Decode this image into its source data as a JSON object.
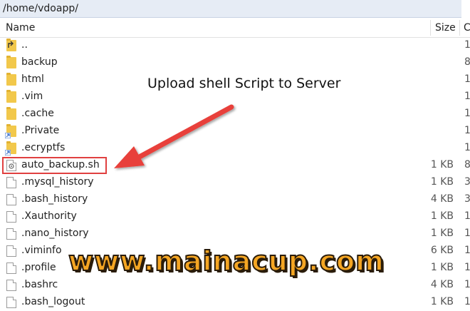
{
  "path": "/home/vdoapp/",
  "columns": {
    "name": "Name",
    "size": "Size",
    "third": "C"
  },
  "rows": [
    {
      "name": "..",
      "size": "",
      "extra": "1",
      "icon": "parent-folder-icon"
    },
    {
      "name": "backup",
      "size": "",
      "extra": "8",
      "icon": "folder-icon"
    },
    {
      "name": "html",
      "size": "",
      "extra": "1",
      "icon": "folder-icon"
    },
    {
      "name": ".vim",
      "size": "",
      "extra": "1",
      "icon": "folder-icon"
    },
    {
      "name": ".cache",
      "size": "",
      "extra": "1",
      "icon": "folder-icon"
    },
    {
      "name": ".Private",
      "size": "",
      "extra": "1",
      "icon": "folder-link-icon"
    },
    {
      "name": ".ecryptfs",
      "size": "",
      "extra": "1",
      "icon": "folder-link-icon"
    },
    {
      "name": "auto_backup.sh",
      "size": "1 KB",
      "extra": "8",
      "icon": "script-file-icon"
    },
    {
      "name": ".mysql_history",
      "size": "1 KB",
      "extra": "3",
      "icon": "file-icon"
    },
    {
      "name": ".bash_history",
      "size": "4 KB",
      "extra": "3",
      "icon": "file-icon"
    },
    {
      "name": ".Xauthority",
      "size": "1 KB",
      "extra": "1",
      "icon": "file-icon"
    },
    {
      "name": ".nano_history",
      "size": "1 KB",
      "extra": "1",
      "icon": "file-icon"
    },
    {
      "name": ".viminfo",
      "size": "6 KB",
      "extra": "1",
      "icon": "file-icon"
    },
    {
      "name": ".profile",
      "size": "1 KB",
      "extra": "1",
      "icon": "file-icon"
    },
    {
      "name": ".bashrc",
      "size": "4 KB",
      "extra": "1",
      "icon": "file-icon"
    },
    {
      "name": ".bash_logout",
      "size": "1 KB",
      "extra": "1",
      "icon": "file-icon"
    }
  ],
  "annotation": "Upload shell Script to Server",
  "watermark": "www.mainacup.com",
  "colors": {
    "highlight": "#e04040",
    "arrow": "#e8413a",
    "folder": "#f2c84b",
    "watermark": "#f5a623"
  }
}
